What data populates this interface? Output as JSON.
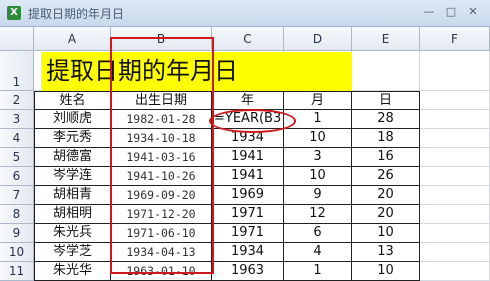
{
  "window": {
    "title": "提取日期的年月日"
  },
  "columns": [
    "A",
    "B",
    "C",
    "D",
    "E",
    "F"
  ],
  "rows": [
    "1",
    "2",
    "3",
    "4",
    "5",
    "6",
    "7",
    "8",
    "9",
    "10",
    "11"
  ],
  "sheet_title": "提取日期的年月日",
  "headers": [
    "姓名",
    "出生日期",
    "年",
    "月",
    "日"
  ],
  "records": [
    {
      "name": "刘顺虎",
      "date": "1982-01-28",
      "year": "=YEAR(B3",
      "month": "1",
      "day": "28"
    },
    {
      "name": "李元秀",
      "date": "1934-10-18",
      "year": "1934",
      "month": "10",
      "day": "18"
    },
    {
      "name": "胡德富",
      "date": "1941-03-16",
      "year": "1941",
      "month": "3",
      "day": "16"
    },
    {
      "name": "岑学连",
      "date": "1941-10-26",
      "year": "1941",
      "month": "10",
      "day": "26"
    },
    {
      "name": "胡相青",
      "date": "1969-09-20",
      "year": "1969",
      "month": "9",
      "day": "20"
    },
    {
      "name": "胡相明",
      "date": "1971-12-20",
      "year": "1971",
      "month": "12",
      "day": "20"
    },
    {
      "name": "朱光兵",
      "date": "1971-06-10",
      "year": "1971",
      "month": "6",
      "day": "10"
    },
    {
      "name": "岑学芝",
      "date": "1934-04-13",
      "year": "1934",
      "month": "4",
      "day": "13"
    },
    {
      "name": "朱光华",
      "date": "1963-01-10",
      "year": "1963",
      "month": "1",
      "day": "10"
    }
  ],
  "colors": {
    "title_fill": "#ffff00",
    "annotation": "#d0181c"
  }
}
